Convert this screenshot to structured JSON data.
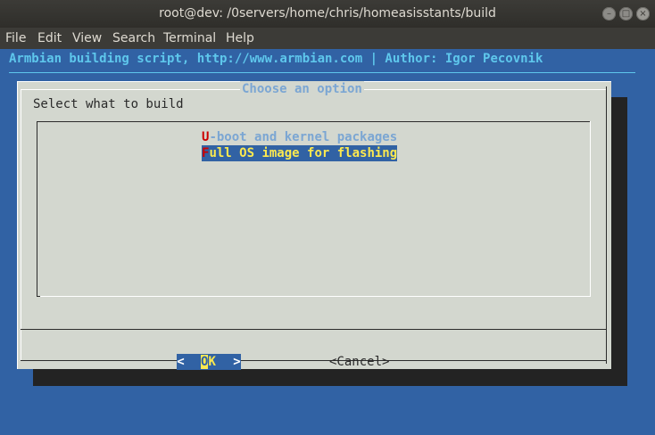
{
  "window": {
    "title": "root@dev: /0servers/home/chris/homeasisstants/build",
    "minimize_glyph": "–",
    "maximize_glyph": "□",
    "close_glyph": "×"
  },
  "menubar": {
    "items": [
      "File",
      "Edit",
      "View",
      "Search",
      "Terminal",
      "Help"
    ]
  },
  "terminal": {
    "backtitle": "Armbian building script, http://www.armbian.com | Author: Igor Pecovnik",
    "colors": {
      "background": "#3162a4",
      "backtitle": "#5ec7ec",
      "dialog": "#d3d7cf",
      "selected": "#fce94f",
      "hotkey": "#cc0000"
    }
  },
  "dialog": {
    "title": "Choose an option",
    "prompt": "Select what to build",
    "options": [
      {
        "hotkey": "U",
        "rest": "-boot and kernel packages",
        "selected": false
      },
      {
        "hotkey": "F",
        "rest": "ull OS image for flashing",
        "selected": true
      }
    ],
    "ok_button": {
      "left": "<",
      "hotkey": "O",
      "rest": "K",
      "right": ">"
    },
    "cancel_button": "<Cancel>"
  }
}
